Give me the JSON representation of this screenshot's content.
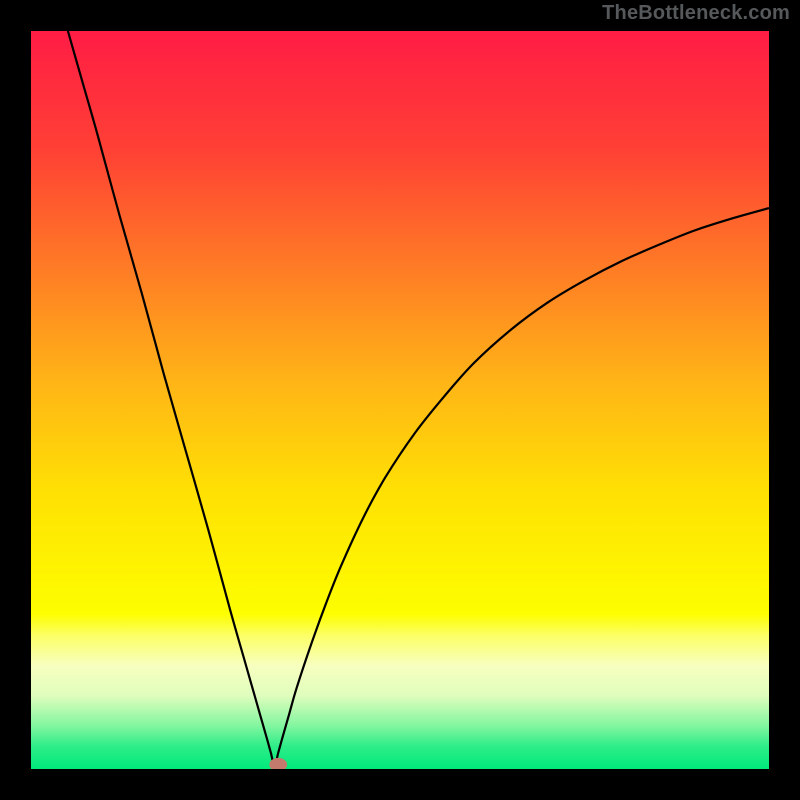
{
  "attribution": "TheBottleneck.com",
  "chart_data": {
    "type": "line",
    "title": "",
    "xlabel": "",
    "ylabel": "",
    "xlim": [
      0,
      100
    ],
    "ylim": [
      0,
      100
    ],
    "legend": false,
    "grid": false,
    "background_gradient": {
      "type": "traffic-light",
      "stops": [
        {
          "t": 0.0,
          "color": "#ff1c45"
        },
        {
          "t": 0.16,
          "color": "#ff4035"
        },
        {
          "t": 0.48,
          "color": "#ffb616"
        },
        {
          "t": 0.63,
          "color": "#ffe203"
        },
        {
          "t": 0.79,
          "color": "#fdfe00"
        },
        {
          "t": 0.82,
          "color": "#fcff68"
        },
        {
          "t": 0.86,
          "color": "#f7ffbf"
        },
        {
          "t": 0.9,
          "color": "#e0fdbd"
        },
        {
          "t": 0.94,
          "color": "#86f6a1"
        },
        {
          "t": 0.97,
          "color": "#2ded88"
        },
        {
          "t": 1.0,
          "color": "#00e97b"
        }
      ]
    },
    "series": [
      {
        "name": "bottleneck-curve",
        "type": "line",
        "color": "#000000",
        "x_min_at": 33,
        "x": [
          5,
          7,
          9,
          12,
          15,
          18,
          21,
          24,
          27,
          29,
          30,
          31,
          32,
          32.5,
          33,
          33.5,
          34,
          35,
          36,
          38,
          40,
          42,
          45,
          48,
          52,
          56,
          60,
          65,
          70,
          75,
          80,
          85,
          90,
          95,
          100
        ],
        "y": [
          100,
          93,
          86,
          75,
          64.5,
          53.5,
          43,
          32.5,
          21.5,
          14.5,
          11,
          7.5,
          4,
          2.2,
          0.4,
          2.2,
          4,
          7.5,
          11,
          17,
          22.5,
          27.5,
          34,
          39.5,
          45.5,
          50.5,
          55,
          59.5,
          63.2,
          66.2,
          68.8,
          71,
          73,
          74.6,
          76
        ]
      }
    ],
    "marker": {
      "name": "highlight-point",
      "x": 33.5,
      "y": 0.6,
      "shape": "ellipse",
      "rx": 1.2,
      "ry": 0.9,
      "color": "#c47a6c"
    }
  }
}
